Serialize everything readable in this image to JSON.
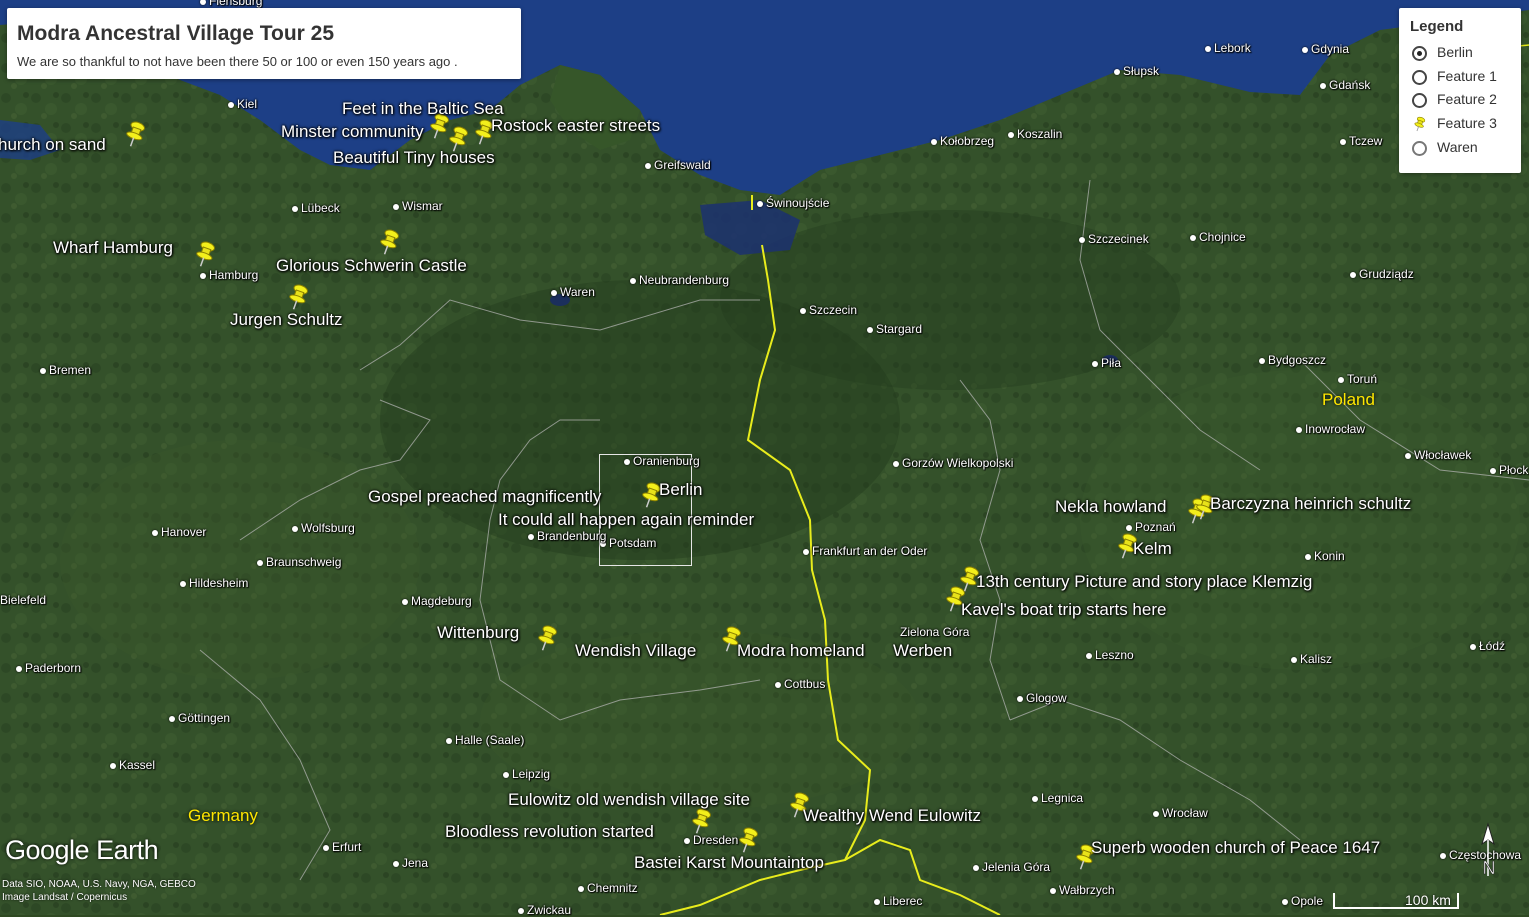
{
  "title": "Modra Ancestral Village Tour 25",
  "subtitle": "We are so thankful to not have been there 50 or 100 or even 150 years ago .",
  "legend": {
    "title": "Legend",
    "items": [
      {
        "label": "Berlin",
        "style": "radio-selected"
      },
      {
        "label": "Feature 1",
        "style": "radio"
      },
      {
        "label": "Feature 2",
        "style": "radio"
      },
      {
        "label": "Feature 3",
        "style": "pushpin"
      },
      {
        "label": "Waren",
        "style": "radio-grey"
      }
    ]
  },
  "countries": [
    "Germany",
    "Poland"
  ],
  "cities": [
    "Flensburg",
    "Kiel",
    "Lübeck",
    "Wismar",
    "Hamburg",
    "Bremen",
    "Waren",
    "Neubrandenburg",
    "Greifswald",
    "Świnoujście",
    "Szczecin",
    "Stargard",
    "Kołobrzeg",
    "Koszalin",
    "Słupsk",
    "Lebork",
    "Gdynia",
    "Gdańsk",
    "Tczew",
    "Szczecinek",
    "Chojnice",
    "Grudziądz",
    "Piła",
    "Bydgoszcz",
    "Toruń",
    "Inowrocław",
    "Włocławek",
    "Płock",
    "Gorzów Wielkopolski",
    "Poznań",
    "Konin",
    "Oranienburg",
    "Potsdam",
    "Brandenburg",
    "Frankfurt an der Oder",
    "Zielona Góra",
    "Leszno",
    "Kalisz",
    "Łódź",
    "Hanover",
    "Wolfsburg",
    "Braunschweig",
    "Hildesheim",
    "Magdeburg",
    "Bielefeld",
    "Paderborn",
    "Göttingen",
    "Kassel",
    "Halle (Saale)",
    "Leipzig",
    "Cottbus",
    "Glogow",
    "Legnica",
    "Wrocław",
    "Jelenia Góra",
    "Wałbrzych",
    "Opole",
    "Częstochowa",
    "Erfurt",
    "Jena",
    "Chemnitz",
    "Zwickau",
    "Dresden",
    "Liberec"
  ],
  "placemarks": [
    "hurch on sand",
    "Feet in the Baltic Sea",
    "Minster community",
    "Rostock easter streets",
    "Beautiful Tiny houses",
    "Wharf Hamburg",
    "Glorious Schwerin Castle",
    "Jurgen Schultz",
    "Gospel preached magnificently",
    "Berlin",
    "It could all happen again reminder",
    "Nekla howland",
    "Barczyzna heinrich schultz",
    "Kelm",
    "13th century Picture and story place Klemzig",
    "Kavel's boat trip starts here",
    "Wittenburg",
    "Wendish Village",
    "Modra homeland",
    "Werben",
    "Eulowitz old wendish village site",
    "Wealthy Wend Eulowitz",
    "Bloodless revolution started",
    "Bastei Karst Mountaintop",
    "Superb wooden church of Peace 1647"
  ],
  "map_ui": {
    "logo": "Google Earth",
    "credits": [
      "Data SIO, NOAA, U.S. Navy, NGA, GEBCO",
      "Image Landsat / Copernicus"
    ],
    "scale": "100 km",
    "north": "N"
  },
  "colors": {
    "sea": "#1d3f86",
    "land": "#33502a",
    "border": "#e8ec1c",
    "pin": "#f3ef1b"
  }
}
